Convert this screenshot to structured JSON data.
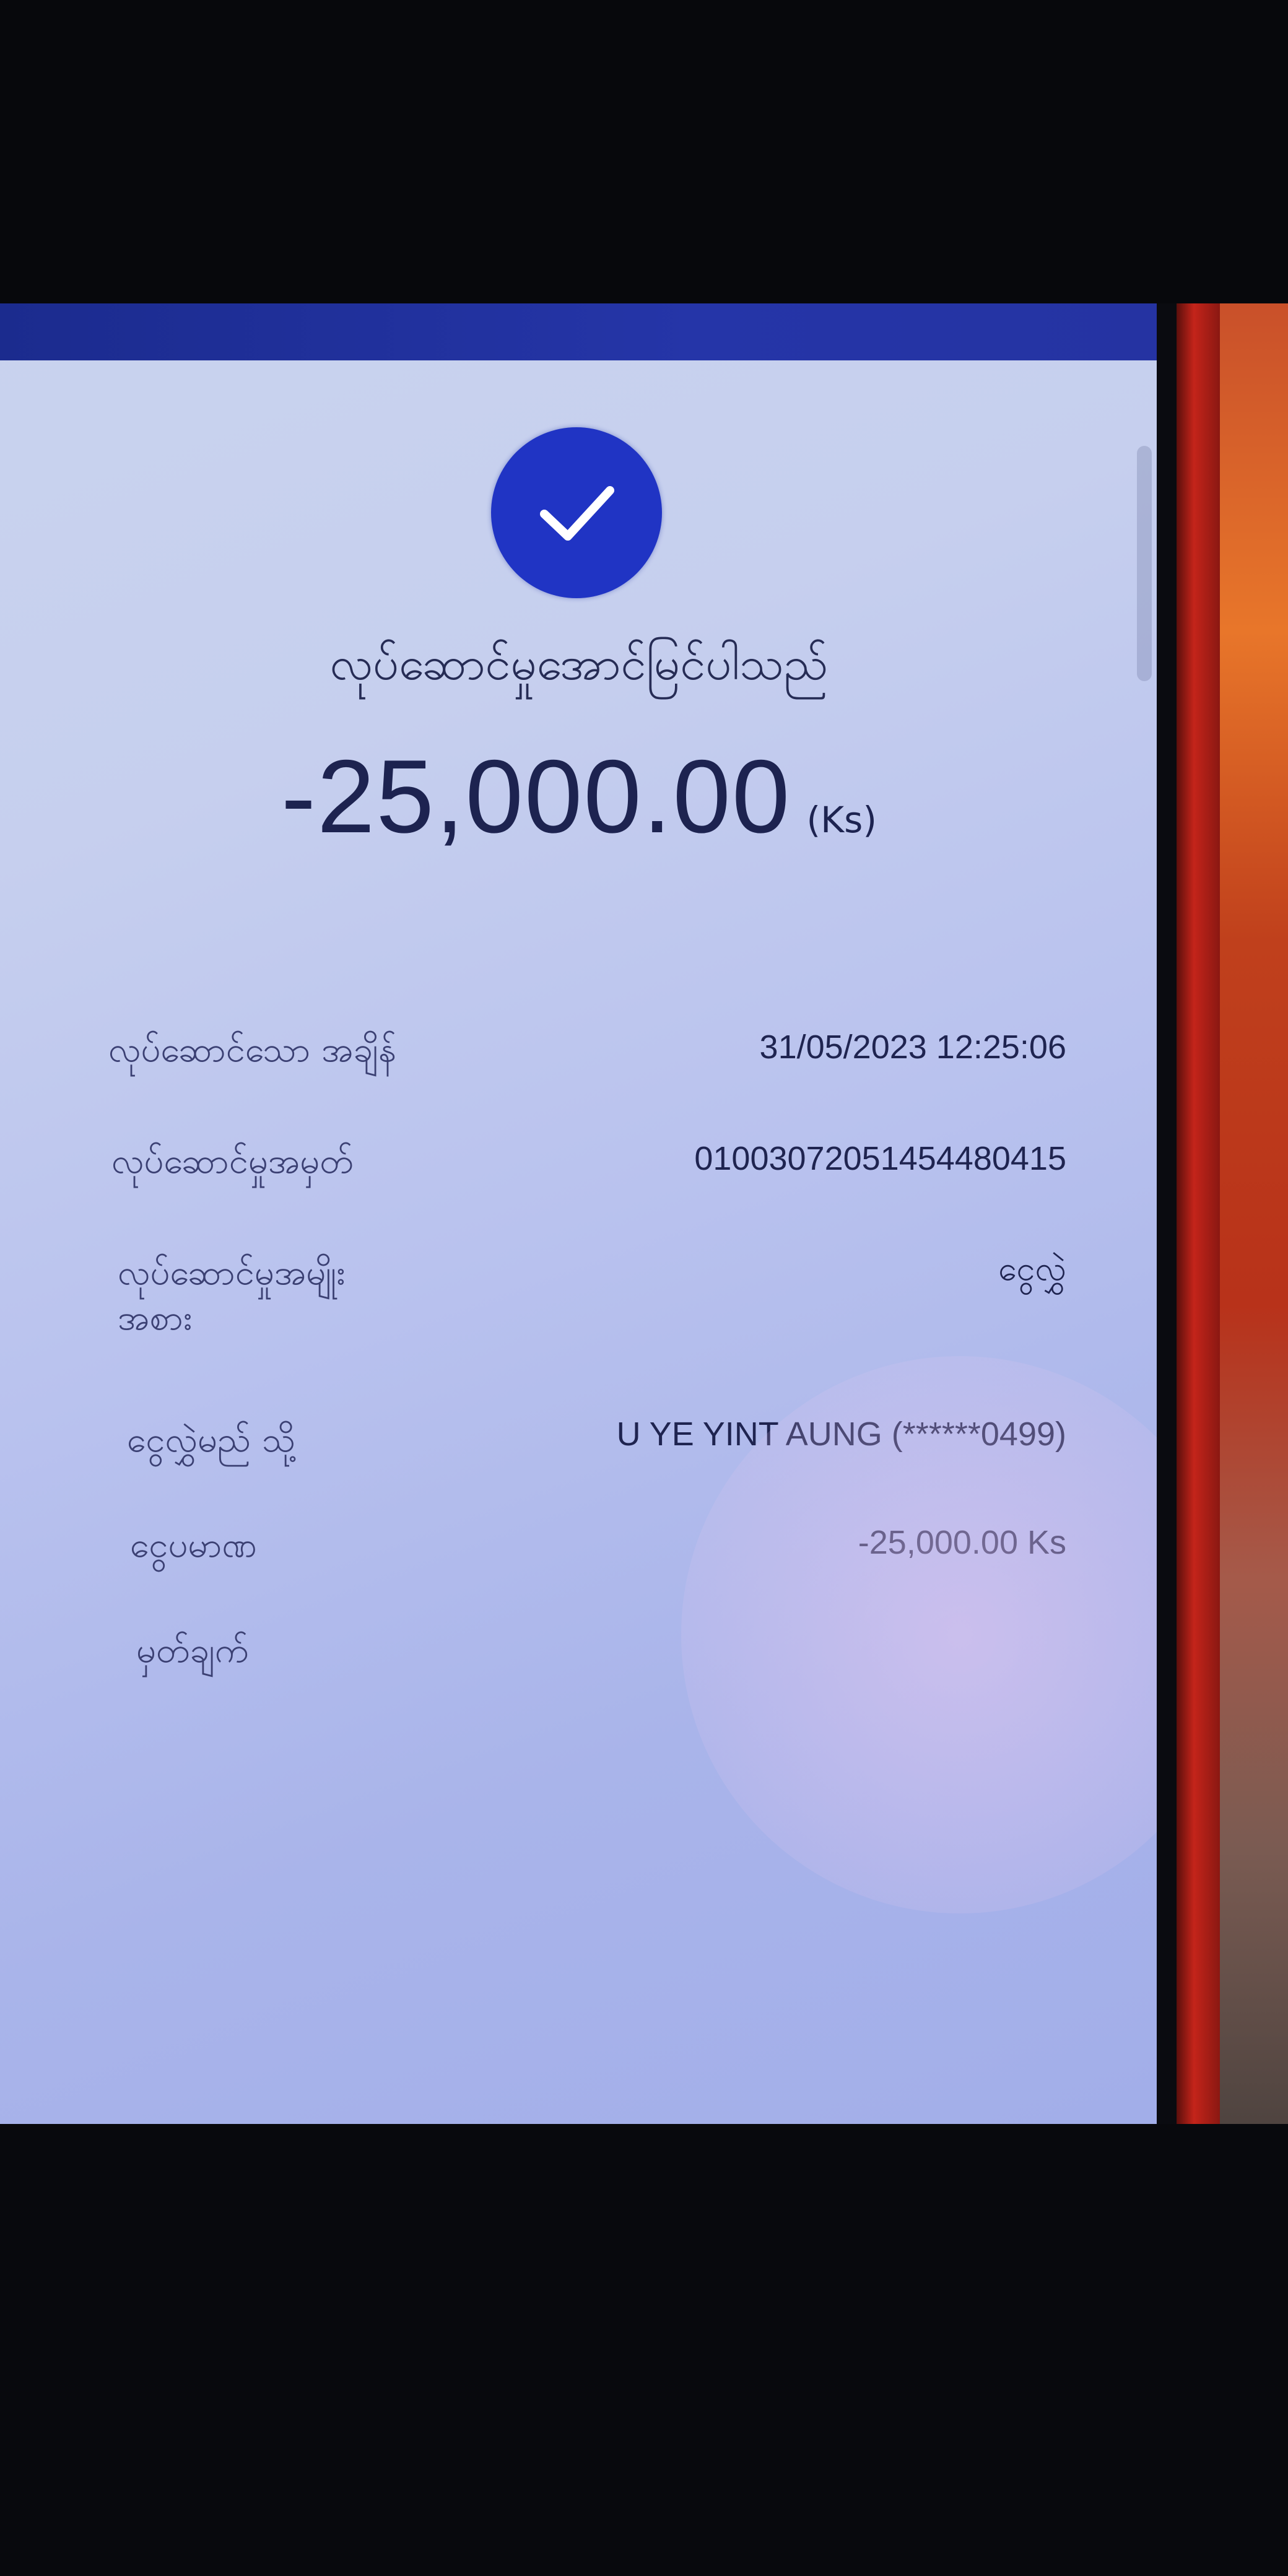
{
  "status": {
    "title": "လုပ်ဆောင်မှုအောင်မြင်ပါသည်",
    "amount": "-25,000.00",
    "currency": "(Ks)",
    "icon": "check-icon",
    "accent": "#2034c4"
  },
  "details": [
    {
      "label": "လုပ်ဆောင်သော အချိန်",
      "value": "31/05/2023 12:25:06"
    },
    {
      "label": "လုပ်ဆောင်မှုအမှတ်",
      "value": "01003072051454480415"
    },
    {
      "label": "လုပ်ဆောင်မှုအမျိုး\nအစား",
      "value": "ငွေလွှဲ"
    },
    {
      "label": "ငွေလွှဲမည် သို့",
      "value": "U YE YINT AUNG (******0499)"
    },
    {
      "label": "ငွေပမာဏ",
      "value": "-25,000.00 Ks"
    },
    {
      "label": "မှတ်ချက်",
      "value": ""
    }
  ],
  "colors": {
    "header_bar": "#1b2b8e",
    "background": "#c6cfee",
    "text": "#1d2350"
  }
}
